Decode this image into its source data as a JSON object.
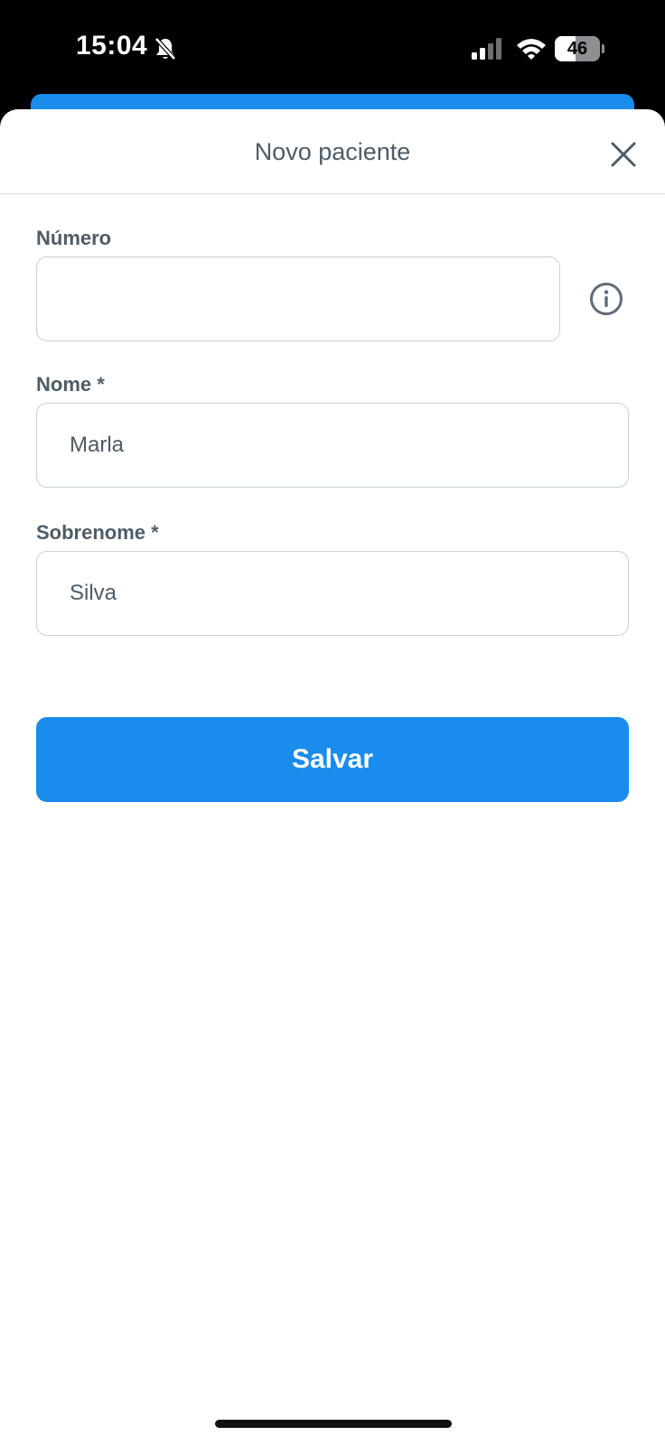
{
  "status_bar": {
    "time": "15:04",
    "battery_text": "46",
    "battery_level": 0.46,
    "icons": [
      "bell-slash-icon",
      "signal-icon",
      "wifi-icon",
      "battery-icon"
    ]
  },
  "modal": {
    "title": "Novo paciente",
    "close_icon": "close-icon"
  },
  "form": {
    "numero": {
      "label": "Número",
      "value": "",
      "placeholder": "",
      "info_icon": "info-icon"
    },
    "nome": {
      "label": "Nome *",
      "value": "Marla"
    },
    "sobrenome": {
      "label": "Sobrenome *",
      "value": "Silva"
    }
  },
  "actions": {
    "save_label": "Salvar"
  },
  "colors": {
    "accent": "#1a8ceb",
    "text": "#4f5b66",
    "border": "#c9d1d6"
  }
}
